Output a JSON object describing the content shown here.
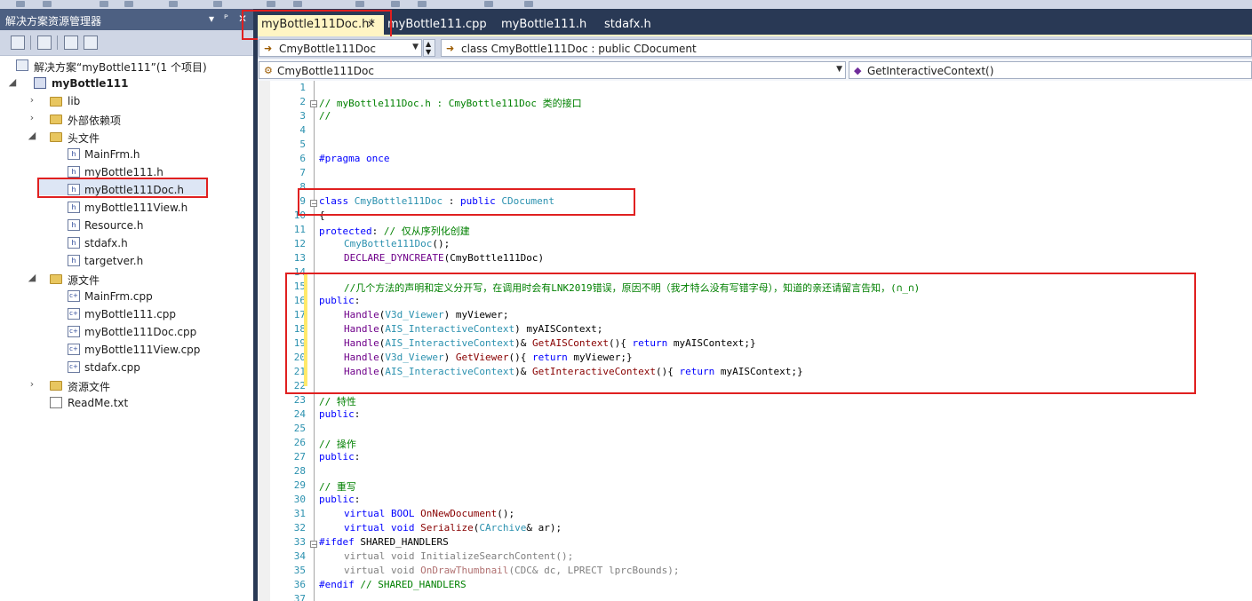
{
  "solution_explorer": {
    "title": "解决方案资源管理器",
    "pin_glyph": "▾",
    "dock_glyph": "ᴾ",
    "close_glyph": "✕",
    "solution_label": "解决方案“myBottle111”(1 个项目)",
    "project_label": "myBottle111",
    "items": {
      "lib": "lib",
      "external": "外部依赖项",
      "headers": "头文件",
      "h_mainfrm": "MainFrm.h",
      "h_bottle": "myBottle111.h",
      "h_doc": "myBottle111Doc.h",
      "h_view": "myBottle111View.h",
      "h_resource": "Resource.h",
      "h_stdafx": "stdafx.h",
      "h_targetver": "targetver.h",
      "sources": "源文件",
      "c_mainfrm": "MainFrm.cpp",
      "c_bottle": "myBottle111.cpp",
      "c_doc": "myBottle111Doc.cpp",
      "c_view": "myBottle111View.cpp",
      "c_stdafx": "stdafx.cpp",
      "resources": "资源文件",
      "readme": "ReadMe.txt"
    }
  },
  "tabs": {
    "active": "myBottle111Doc.h*",
    "tab2": "myBottle111.cpp",
    "tab3": "myBottle111.h",
    "tab4": "stdafx.h",
    "close_glyph": "✕"
  },
  "navbar": {
    "class_combo": "CmyBottle111Doc",
    "class_decl": "class CmyBottle111Doc : public CDocument",
    "scope_combo": "CmyBottle111Doc",
    "member_combo": "GetInteractiveContext()"
  },
  "code": {
    "line_numbers": [
      "1",
      "2",
      "3",
      "4",
      "5",
      "6",
      "7",
      "8",
      "9",
      "10",
      "11",
      "12",
      "13",
      "14",
      "15",
      "16",
      "17",
      "18",
      "19",
      "20",
      "21",
      "22",
      "23",
      "24",
      "25",
      "26",
      "27",
      "28",
      "29",
      "30",
      "31",
      "32",
      "33",
      "34",
      "35",
      "36",
      "37"
    ],
    "l2": "// myBottle111Doc.h : CmyBottle111Doc 类的接口",
    "l3": "//",
    "l6_kw": "#pragma once",
    "l9_kw1": "class",
    "l9_name": " CmyBottle111Doc",
    "l9_sep": " : ",
    "l9_kw2": "public",
    "l9_base": " CDocument",
    "l10": "{",
    "l11_kw": "protected",
    "l11_rest": ": ",
    "l11_cm": "// 仅从序列化创建",
    "l12_name": "CmyBottle111Doc",
    "l12_rest": "();",
    "l13_mac": "DECLARE_DYNCREATE",
    "l13_rest": "(CmyBottle111Doc)",
    "l15_cm": "//几个方法的声明和定义分开写，在调用时会有LNK2019错误，原因不明（我才特么没有写错字母），知道的亲还请留言告知，(∩_∩)",
    "l16_kw": "public",
    "l16_rest": ":",
    "l17_t1": "Handle",
    "l17_p1": "(",
    "l17_t2": "V3d_Viewer",
    "l17_rest": ") myViewer;",
    "l18_t1": "Handle",
    "l18_p1": "(",
    "l18_t2": "AIS_InteractiveContext",
    "l18_rest": ") myAISContext;",
    "l19_t1": "Handle",
    "l19_p1": "(",
    "l19_t2": "AIS_InteractiveContext",
    "l19_mid": ")& ",
    "l19_fn": "GetAISContext",
    "l19_p2": "(){ ",
    "l19_kw": "return",
    "l19_rest": " myAISContext;}",
    "l20_t1": "Handle",
    "l20_p1": "(",
    "l20_t2": "V3d_Viewer",
    "l20_mid": ") ",
    "l20_fn": "GetViewer",
    "l20_p2": "(){ ",
    "l20_kw": "return",
    "l20_rest": " myViewer;}",
    "l21_t1": "Handle",
    "l21_p1": "(",
    "l21_t2": "AIS_InteractiveContext",
    "l21_mid": ")& ",
    "l21_fn": "GetInteractiveContext",
    "l21_p2": "(){ ",
    "l21_kw": "return",
    "l21_rest": " myAISContext;}",
    "l23_cm": "// 特性",
    "l24_kw": "public",
    "l24_rest": ":",
    "l26_cm": "// 操作",
    "l27_kw": "public",
    "l27_rest": ":",
    "l29_cm": "// 重写",
    "l30_kw": "public",
    "l30_rest": ":",
    "l31_kw": "virtual",
    "l31_ty": " BOOL",
    "l31_fn": " OnNewDocument",
    "l31_rest": "();",
    "l32_kw": "virtual",
    "l32_ty": " void",
    "l32_fn": " Serialize",
    "l32_p": "(",
    "l32_ty2": "CArchive",
    "l32_rest": "& ar);",
    "l33_pp": "#ifdef",
    "l33_rest": " SHARED_HANDLERS",
    "l34": "virtual void InitializeSearchContent();",
    "l35_a": "virtual void ",
    "l35_fn": "OnDrawThumbnail",
    "l35_b": "(CDC& dc, LPRECT lprcBounds);",
    "l36_pp": "#endif",
    "l36_cm": " // SHARED_HANDLERS"
  }
}
